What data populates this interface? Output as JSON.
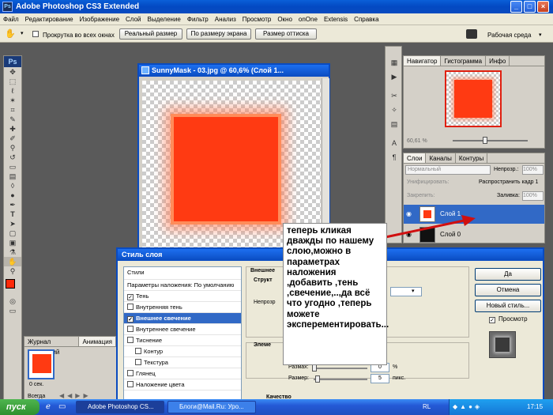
{
  "window": {
    "title": "Adobe Photoshop CS3 Extended",
    "ps_label": "Ps",
    "minimize": "_",
    "maximize": "□",
    "close": "×"
  },
  "menu": [
    "Файл",
    "Редактирование",
    "Изображение",
    "Слой",
    "Выделение",
    "Фильтр",
    "Анализ",
    "Просмотр",
    "Окно",
    "onOne",
    "Extensis",
    "Справка"
  ],
  "options": {
    "checkbox_label": "Прокрутка во всех окнах",
    "btn_actual": "Реальный размер",
    "btn_fit": "По размеру экрана",
    "btn_print": "Размер оттиска",
    "workspace": "Рабочая среда"
  },
  "document": {
    "title": "SunnyMask - 03.jpg @ 60,6% (Слой 1..."
  },
  "navigator": {
    "tabs": [
      "Навигатор",
      "Гистограмма",
      "Инфо"
    ],
    "zoom": "60,61 %"
  },
  "layers": {
    "tabs": [
      "Слои",
      "Каналы",
      "Контуры"
    ],
    "blend_mode": "Нормальный",
    "opacity_label": "Непрозр.:",
    "opacity_value": "100%",
    "unify_label": "Унифицировать:",
    "propagate_label": "Распространить кадр 1",
    "lock_label": "Закрепить:",
    "fill_label": "Заливка:",
    "fill_value": "100%",
    "rows": [
      {
        "name": "Слой 1",
        "selected": true
      },
      {
        "name": "Слой 0",
        "selected": false
      }
    ]
  },
  "dialog": {
    "title": "Стиль слоя",
    "styles": [
      {
        "label": "Стили",
        "checkbox": false,
        "checked": false
      },
      {
        "label": "Параметры наложения: По умолчанию",
        "checkbox": false,
        "checked": false
      },
      {
        "label": "Тень",
        "checkbox": true,
        "checked": true
      },
      {
        "label": "Внутренняя тень",
        "checkbox": true,
        "checked": false
      },
      {
        "label": "Внешнее свечение",
        "checkbox": true,
        "checked": true,
        "selected": true
      },
      {
        "label": "Внутреннее свечение",
        "checkbox": true,
        "checked": false
      },
      {
        "label": "Тиснение",
        "checkbox": true,
        "checked": false
      },
      {
        "label": "Контур",
        "checkbox": true,
        "checked": false,
        "indent": true
      },
      {
        "label": "Текстура",
        "checkbox": true,
        "checked": false,
        "indent": true
      },
      {
        "label": "Глянец",
        "checkbox": true,
        "checked": false
      },
      {
        "label": "Наложение цвета",
        "checkbox": true,
        "checked": false
      }
    ],
    "section_outer": "Внешнее",
    "section_struct": "Структ",
    "label_opacity": "Непрозр",
    "section_elem": "Элеме",
    "label_spread": "Размах:",
    "spread_value": "0",
    "spread_unit": "%",
    "label_size": "Размер:",
    "size_value": "5",
    "size_unit": "пикс.",
    "section_quality": "Качество",
    "btn_ok": "Да",
    "btn_cancel": "Отмена",
    "btn_new_style": "Новый стиль...",
    "preview_label": "Просмотр",
    "preview_checked": "✓",
    "checkmark": "✓"
  },
  "note": {
    "text": "теперь кликая дважды по нашему слою,можно в параметрах наложения ,добавить ,тень ,свечение,..,да всё что угодно ,теперь можете эксперементировать..."
  },
  "journal": {
    "tabs": [
      "Журнал измерений",
      "Анимация"
    ],
    "frame_time": "0 сек.",
    "loop": "Всегда"
  },
  "taskbar": {
    "start": "пуск",
    "tasks": [
      "Adobe Photoshop CS...",
      "Блоги@Mail.Ru: Уро..."
    ],
    "lang": "RL",
    "time": "17:15"
  },
  "clock_small": "17:15"
}
